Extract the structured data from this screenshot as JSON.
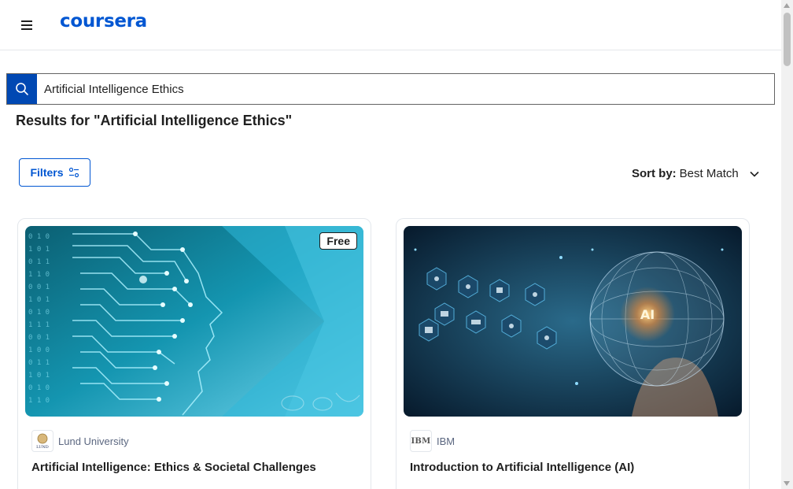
{
  "header": {
    "logo_text": "coursera",
    "menu_icon": "hamburger-menu-icon"
  },
  "search": {
    "value": "Artificial Intelligence Ethics",
    "icon": "search-icon"
  },
  "results": {
    "title": "Results for \"Artificial Intelligence Ethics\""
  },
  "toolbar": {
    "filters_label": "Filters",
    "filters_icon": "sliders-icon",
    "sort_label": "Sort by:",
    "sort_value": "Best Match",
    "sort_icon": "chevron-down-icon"
  },
  "cards": [
    {
      "badge": "Free",
      "partner": "Lund University",
      "partner_logo_text": "LUND",
      "title": "Artificial Intelligence: Ethics & Societal Challenges"
    },
    {
      "partner": "IBM",
      "partner_logo_text": "IBM",
      "title": "Introduction to Artificial Intelligence (AI)"
    }
  ],
  "colors": {
    "brand": "#0056d2",
    "search_button": "#0048b3",
    "text": "#1f1f1f",
    "muted": "#5b6780"
  }
}
